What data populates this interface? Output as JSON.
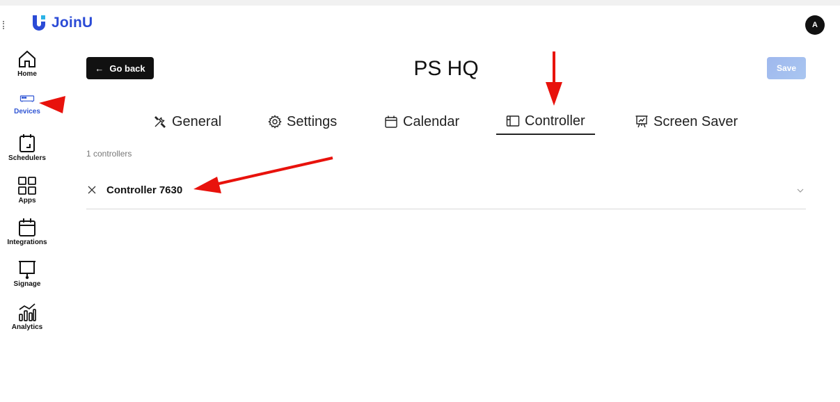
{
  "app": {
    "brand": "JoinU",
    "brand_color": "#2b4bd6",
    "avatar_letter": "A"
  },
  "sidebar": {
    "items": [
      {
        "label": "Home",
        "icon": "home-icon"
      },
      {
        "label": "Devices",
        "icon": "devices-icon",
        "active": true
      },
      {
        "label": "Schedulers",
        "icon": "schedulers-icon"
      },
      {
        "label": "Apps",
        "icon": "apps-icon"
      },
      {
        "label": "Integrations",
        "icon": "calendar-icon"
      },
      {
        "label": "Signage",
        "icon": "signage-icon"
      },
      {
        "label": "Analytics",
        "icon": "analytics-icon"
      }
    ]
  },
  "header": {
    "back_label": "Go back",
    "title": "PS HQ",
    "save_label": "Save"
  },
  "tabs": [
    {
      "label": "General",
      "icon": "tools-icon"
    },
    {
      "label": "Settings",
      "icon": "gear-icon"
    },
    {
      "label": "Calendar",
      "icon": "calendar-icon"
    },
    {
      "label": "Controller",
      "icon": "controller-icon",
      "active": true
    },
    {
      "label": "Screen Saver",
      "icon": "presentation-icon"
    }
  ],
  "controllers": {
    "count_label": "1 controllers",
    "items": [
      {
        "name": "Controller 7630",
        "expanded": false
      }
    ]
  },
  "colors": {
    "active_nav": "#2f55d4",
    "save_button": "#a5bfef",
    "annotation_arrow": "#e8120c"
  }
}
